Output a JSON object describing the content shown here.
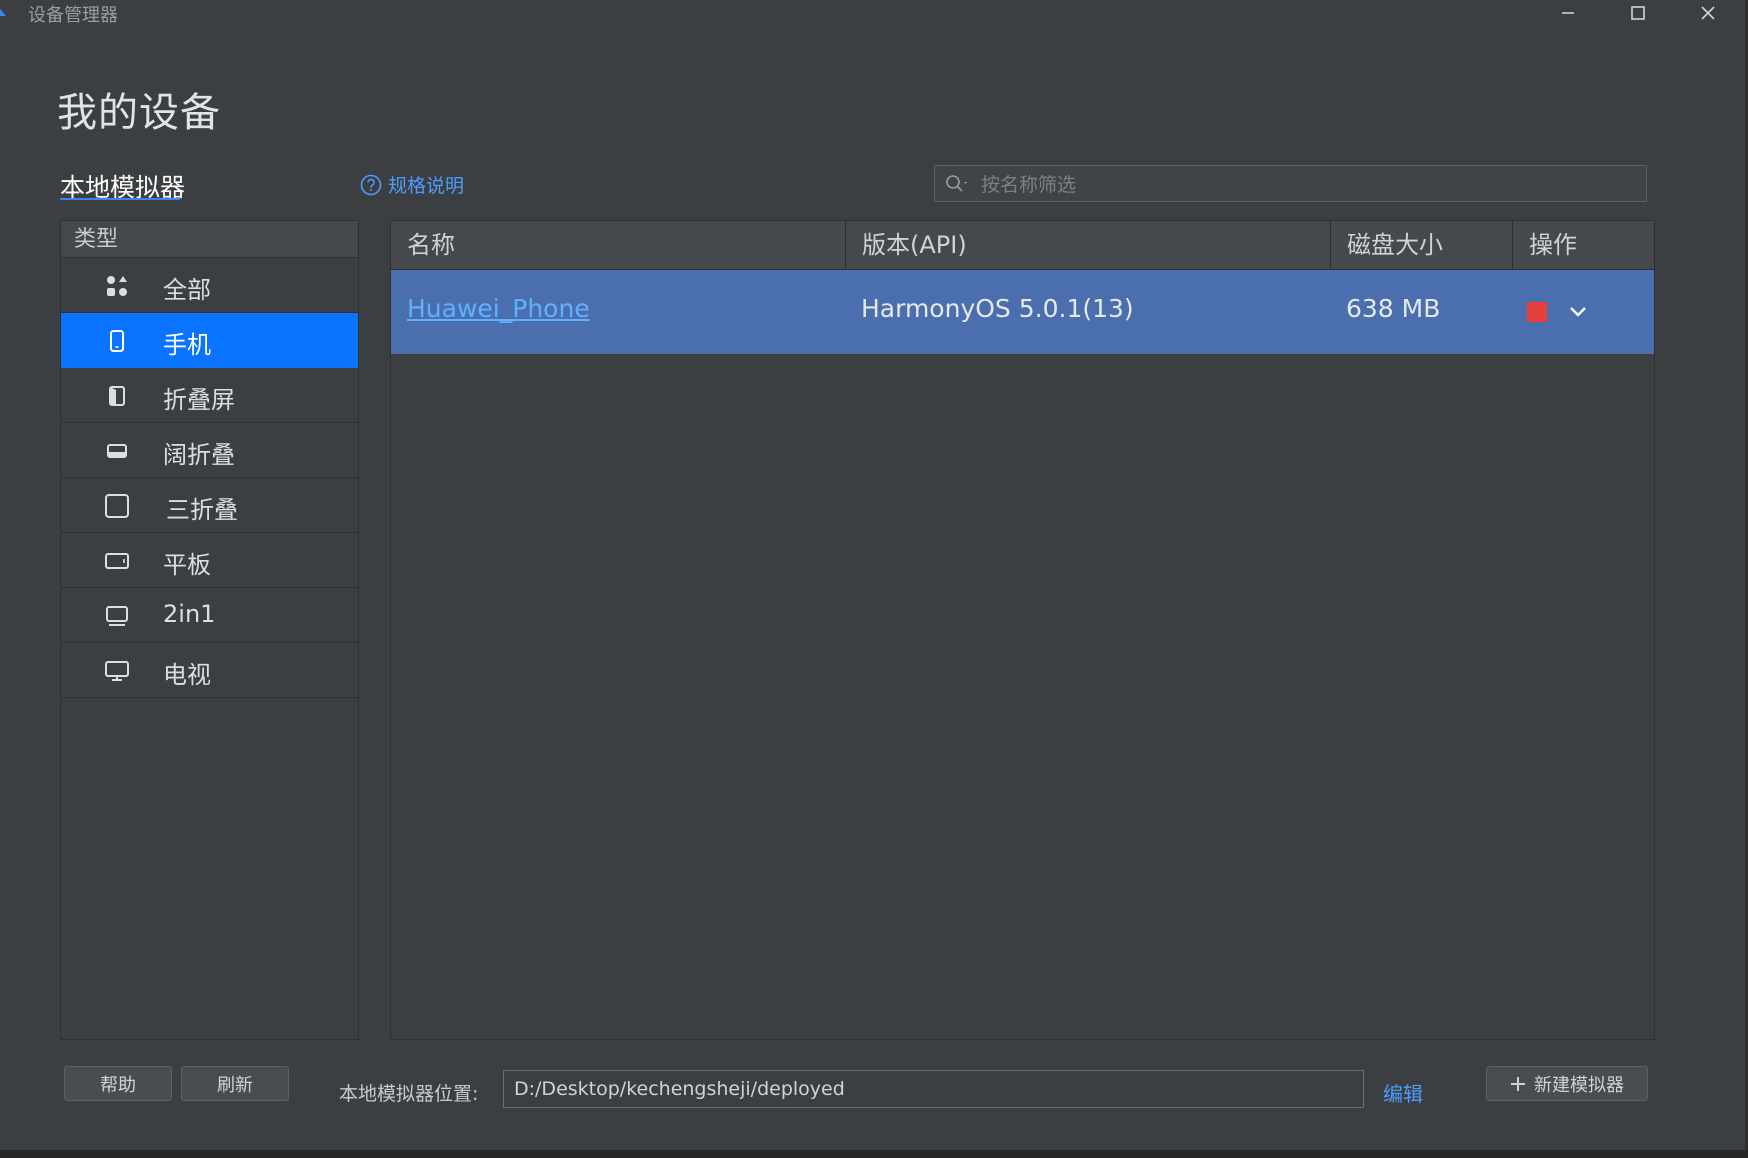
{
  "window": {
    "title": "设备管理器"
  },
  "page": {
    "title": "我的设备"
  },
  "tabs": {
    "local": "本地模拟器"
  },
  "spec_link": {
    "label": "规格说明"
  },
  "search": {
    "placeholder": "按名称筛选",
    "value": ""
  },
  "type_panel": {
    "header": "类型",
    "items": [
      {
        "label": "全部",
        "icon": "apps-grid-icon",
        "selected": false
      },
      {
        "label": "手机",
        "icon": "phone-icon",
        "selected": true
      },
      {
        "label": "折叠屏",
        "icon": "foldable-icon",
        "selected": false
      },
      {
        "label": "阔折叠",
        "icon": "wide-fold-icon",
        "selected": false
      },
      {
        "label": "三折叠",
        "icon": "tri-fold-icon",
        "selected": false
      },
      {
        "label": "平板",
        "icon": "tablet-icon",
        "selected": false
      },
      {
        "label": "2in1",
        "icon": "laptop-icon",
        "selected": false
      },
      {
        "label": "电视",
        "icon": "tv-icon",
        "selected": false
      }
    ]
  },
  "table": {
    "columns": {
      "name": "名称",
      "version": "版本(API)",
      "disk": "磁盘大小",
      "actions": "操作"
    },
    "rows": [
      {
        "name": "Huawei_Phone",
        "version": "HarmonyOS 5.0.1(13)",
        "disk": "638 MB"
      }
    ]
  },
  "footer": {
    "help": "帮助",
    "refresh": "刷新",
    "location_label": "本地模拟器位置:",
    "location_value": "D:/Desktop/kechengsheji/deployed",
    "edit": "编辑",
    "new_emulator": "新建模拟器"
  },
  "colors": {
    "accent": "#0a73ff",
    "link": "#4d9bff",
    "row_selected": "#4b6eaf",
    "stop": "#e5403a",
    "background": "#3c3f41"
  }
}
